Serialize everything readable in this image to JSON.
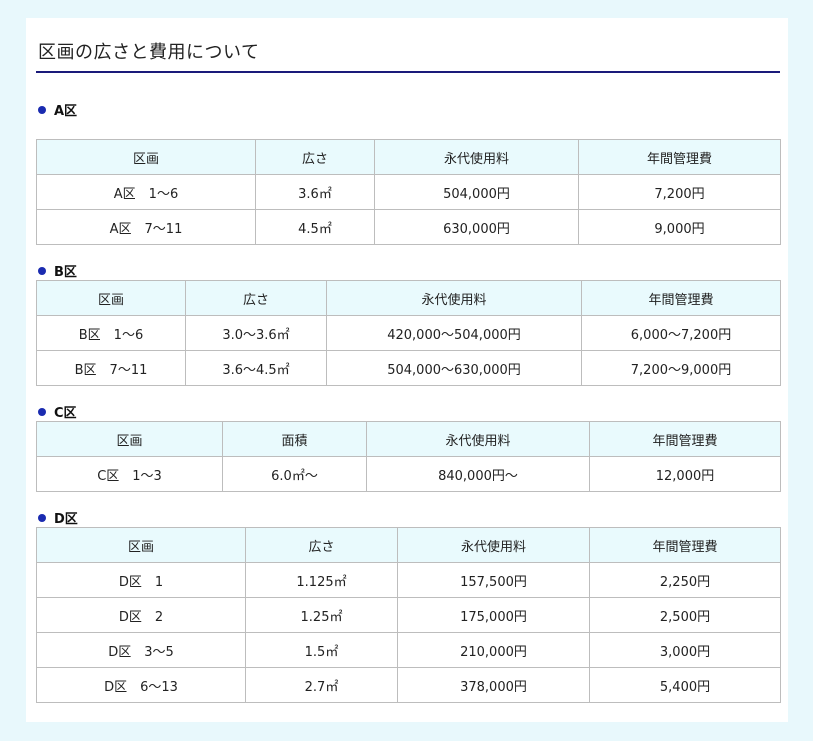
{
  "title": "区画の広さと費用について",
  "sections": [
    {
      "heading": "A区",
      "headers": [
        "区画",
        "広さ",
        "永代使用料",
        "年間管理費"
      ],
      "rows": [
        [
          "A区　1〜6",
          "3.6㎡",
          "504,000円",
          "7,200円"
        ],
        [
          "A区　7〜11",
          "4.5㎡",
          "630,000円",
          "9,000円"
        ]
      ]
    },
    {
      "heading": "B区",
      "headers": [
        "区画",
        "広さ",
        "永代使用料",
        "年間管理費"
      ],
      "rows": [
        [
          "B区　1〜6",
          "3.0〜3.6㎡",
          "420,000〜504,000円",
          "6,000〜7,200円"
        ],
        [
          "B区　7〜11",
          "3.6〜4.5㎡",
          "504,000〜630,000円",
          "7,200〜9,000円"
        ]
      ]
    },
    {
      "heading": "C区",
      "headers": [
        "区画",
        "面積",
        "永代使用料",
        "年間管理費"
      ],
      "rows": [
        [
          "C区　1〜3",
          "6.0㎡〜",
          "840,000円〜",
          "12,000円"
        ]
      ]
    },
    {
      "heading": "D区",
      "headers": [
        "区画",
        "広さ",
        "永代使用料",
        "年間管理費"
      ],
      "rows": [
        [
          "D区　1",
          "1.125㎡",
          "157,500円",
          "2,250円"
        ],
        [
          "D区　2",
          "1.25㎡",
          "175,000円",
          "2,500円"
        ],
        [
          "D区　3〜5",
          "1.5㎡",
          "210,000円",
          "3,000円"
        ],
        [
          "D区　6〜13",
          "2.7㎡",
          "378,000円",
          "5,400円"
        ]
      ]
    }
  ]
}
